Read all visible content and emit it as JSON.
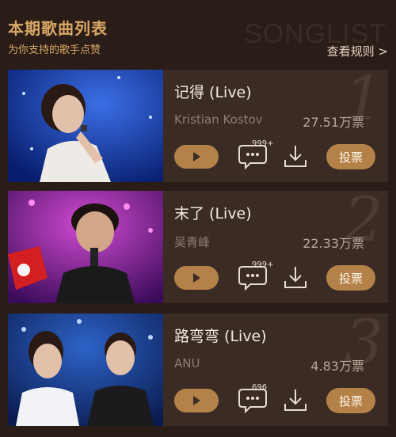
{
  "header": {
    "title": "本期歌曲列表",
    "subtitle": "为你支持的歌手点赞",
    "watermark": "SONGLIST",
    "rules_link": "查看规则 >"
  },
  "songs": [
    {
      "rank": "1",
      "title": "记得 (Live)",
      "artist": "Kristian Kostov",
      "votes": "27.51万票",
      "comments": "999+",
      "vote_label": "投票",
      "thumb_palette": [
        "#0b2a8a",
        "#2d5ae0",
        "#e9e5e7"
      ]
    },
    {
      "rank": "2",
      "title": "末了 (Live)",
      "artist": "吴青峰",
      "votes": "22.33万票",
      "comments": "999+",
      "vote_label": "投票",
      "thumb_palette": [
        "#5a1080",
        "#c03ac0",
        "#d02020"
      ]
    },
    {
      "rank": "3",
      "title": "路弯弯 (Live)",
      "artist": "ANU",
      "votes": "4.83万票",
      "comments": "696",
      "vote_label": "投票",
      "thumb_palette": [
        "#0c2a6a",
        "#2b63c8",
        "#e9eef4"
      ]
    }
  ]
}
